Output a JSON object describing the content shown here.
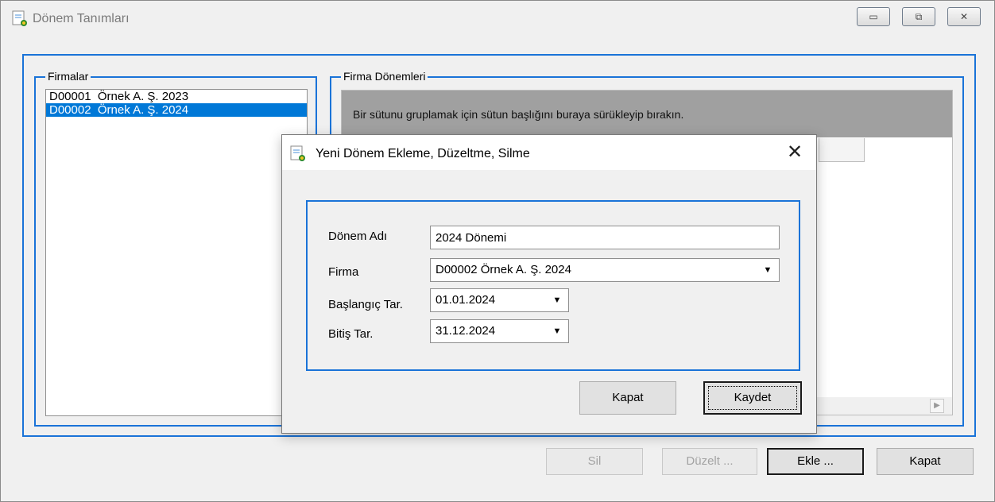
{
  "window": {
    "title": "Dönem Tanımları",
    "icon": "app-icon",
    "controls": {
      "minimize": "▭",
      "restore": "⧉",
      "close": "✕"
    }
  },
  "firms": {
    "legend": "Firmalar",
    "items": [
      {
        "label": "D00001  Örnek A. Ş. 2023",
        "selected": false
      },
      {
        "label": "D00002  Örnek A. Ş. 2024",
        "selected": true
      }
    ]
  },
  "periods": {
    "legend": "Firma Dönemleri",
    "group_hint": "Bir sütunu gruplamak için sütun başlığını buraya sürükleyip bırakın.",
    "scroll_right": "▶"
  },
  "actions": {
    "delete": "Sil",
    "edit": "Düzelt ...",
    "add": "Ekle ...",
    "close": "Kapat"
  },
  "dialog": {
    "title": "Yeni Dönem Ekleme, Düzeltme, Silme",
    "close_glyph": "✕",
    "fields": {
      "period_name_label": "Dönem Adı",
      "period_name_value": "2024 Dönemi",
      "firm_label": "Firma",
      "firm_value": "D00002  Örnek A. Ş. 2024",
      "start_label": "Başlangıç Tar.",
      "start_value": "01.01.2024",
      "end_label": "Bitiş Tar.",
      "end_value": "31.12.2024"
    },
    "dropdown_glyph": "▼",
    "buttons": {
      "close": "Kapat",
      "save": "Kaydet"
    }
  },
  "colors": {
    "accent_blue": "#1a73d8",
    "selection": "#0078d7",
    "group_panel": "#a0a0a0",
    "window_bg": "#f0f0f0"
  }
}
